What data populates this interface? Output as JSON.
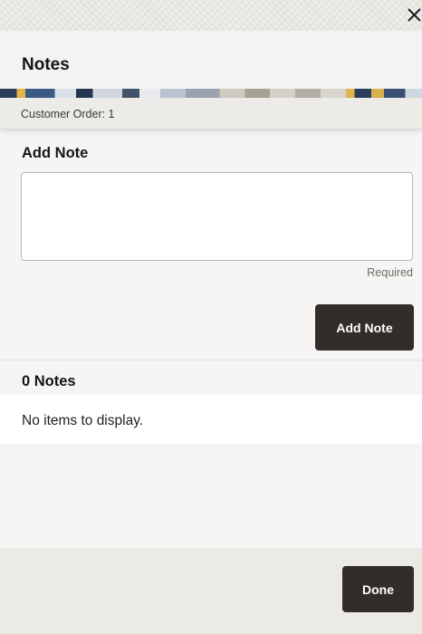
{
  "dialog": {
    "title": "Notes",
    "subheader": "Customer Order: 1"
  },
  "add_note": {
    "heading": "Add Note",
    "textarea_value": "",
    "required_text": "Required",
    "button_label": "Add Note"
  },
  "notes_list": {
    "count_label": "0 Notes",
    "empty_message": "No items to display."
  },
  "footer": {
    "done_label": "Done"
  }
}
